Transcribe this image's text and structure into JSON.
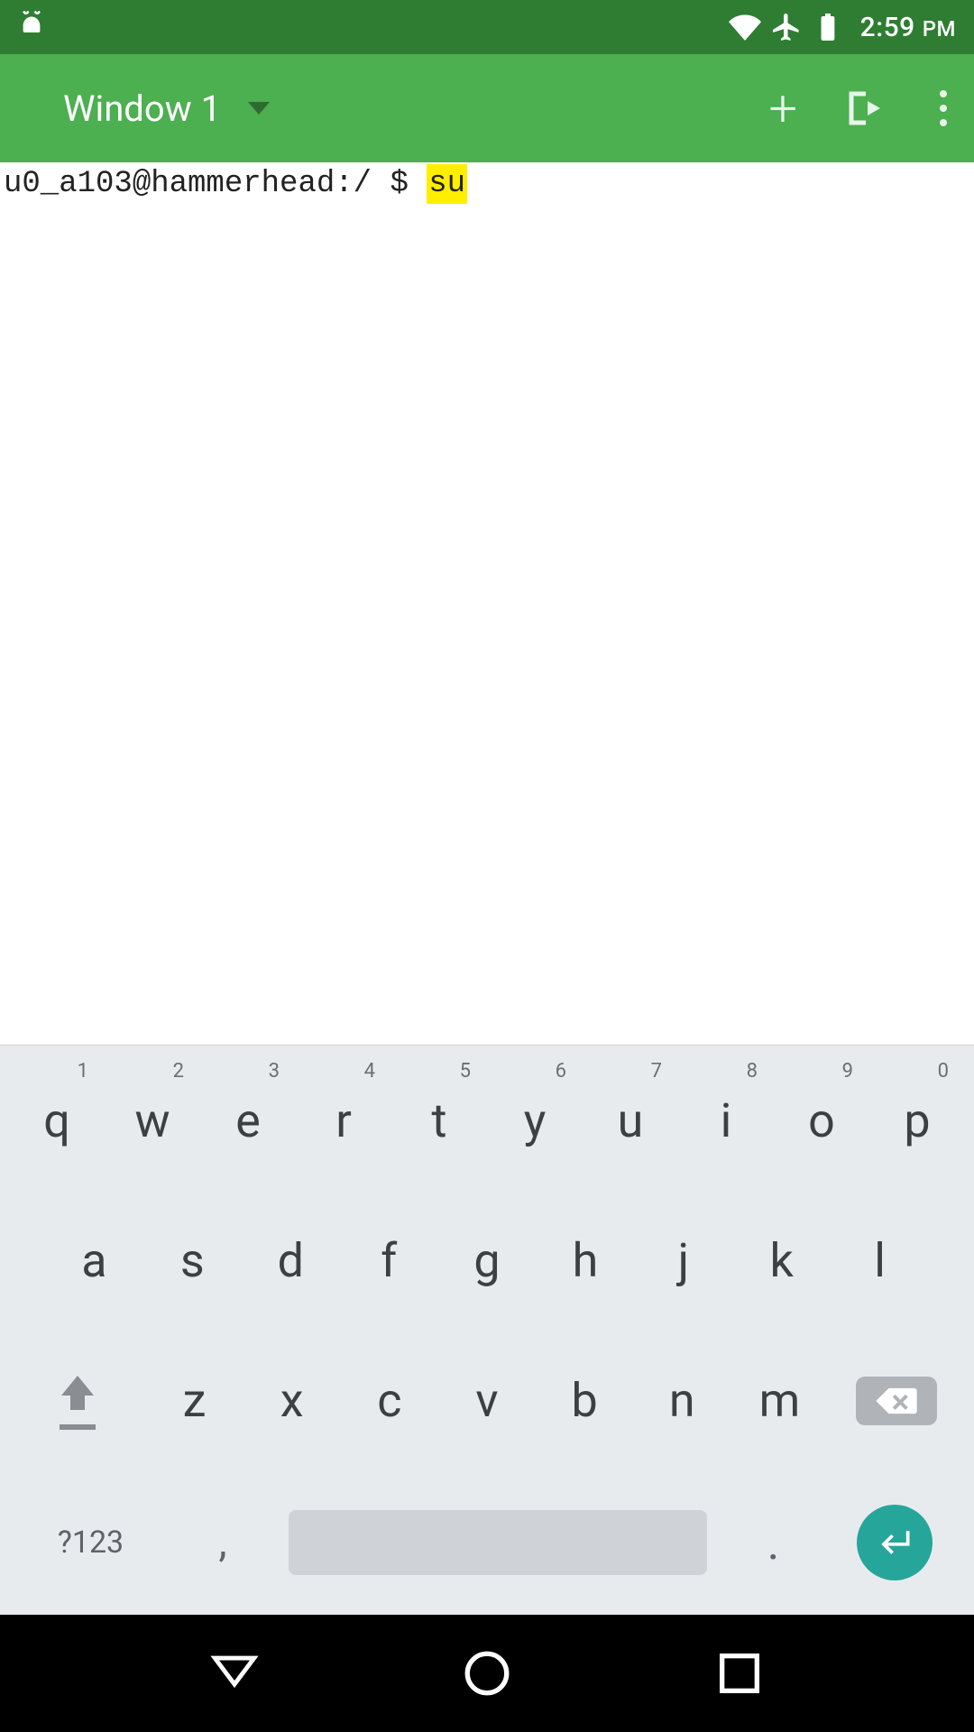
{
  "status_bar": {
    "wifi_icon": "wifi",
    "airplane_icon": "airplane",
    "battery_icon": "battery-full",
    "time": "2:59",
    "ampm": "PM"
  },
  "app_bar": {
    "window_label": "Window 1",
    "add_icon": "plus",
    "exit_icon": "exit",
    "overflow_icon": "kebab"
  },
  "terminal": {
    "prompt": "u0_a103@hammerhead:/ $ ",
    "command_highlight": "su"
  },
  "keyboard": {
    "row1": [
      {
        "super": "1",
        "main": "q"
      },
      {
        "super": "2",
        "main": "w"
      },
      {
        "super": "3",
        "main": "e"
      },
      {
        "super": "4",
        "main": "r"
      },
      {
        "super": "5",
        "main": "t"
      },
      {
        "super": "6",
        "main": "y"
      },
      {
        "super": "7",
        "main": "u"
      },
      {
        "super": "8",
        "main": "i"
      },
      {
        "super": "9",
        "main": "o"
      },
      {
        "super": "0",
        "main": "p"
      }
    ],
    "row2": [
      {
        "main": "a"
      },
      {
        "main": "s"
      },
      {
        "main": "d"
      },
      {
        "main": "f"
      },
      {
        "main": "g"
      },
      {
        "main": "h"
      },
      {
        "main": "j"
      },
      {
        "main": "k"
      },
      {
        "main": "l"
      }
    ],
    "row3": [
      {
        "main": "z"
      },
      {
        "main": "x"
      },
      {
        "main": "c"
      },
      {
        "main": "v"
      },
      {
        "main": "b"
      },
      {
        "main": "n"
      },
      {
        "main": "m"
      }
    ],
    "sym_label": "?123",
    "comma": ",",
    "dot": "."
  }
}
